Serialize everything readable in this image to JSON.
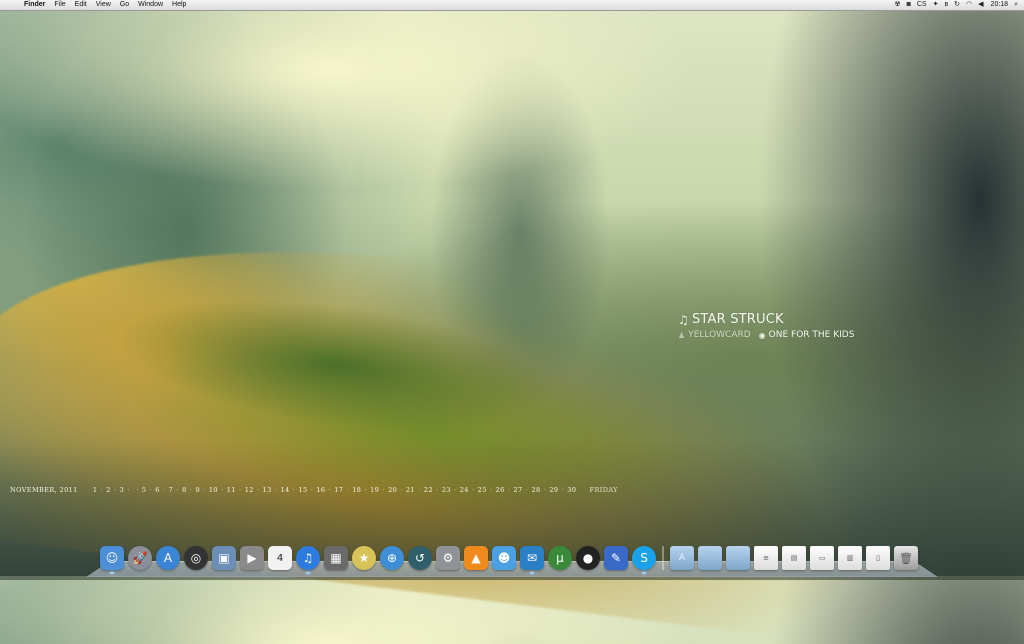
{
  "menubar": {
    "apple": "",
    "app": "Finder",
    "items": [
      "File",
      "Edit",
      "View",
      "Go",
      "Window",
      "Help"
    ],
    "status_icons": [
      "radiation-icon",
      "camera-icon",
      "cs-indicator",
      "twitter-icon",
      "bluetooth-icon",
      "timemachine-icon",
      "wifi-icon",
      "volume-icon"
    ],
    "status_text": "CS",
    "clock": "20:18",
    "spotlight": "search-icon"
  },
  "now_playing": {
    "song": "STAR STRUCK",
    "artist": "YELLOWCARD",
    "album": "ONE FOR THE KIDS"
  },
  "calendar": {
    "month": "NOVEMBER, 2011",
    "days": [
      "1",
      "2",
      "3",
      "",
      "5",
      "6",
      "7",
      "8",
      "9",
      "10",
      "11",
      "12",
      "13",
      "14",
      "15",
      "16",
      "17",
      "18",
      "19",
      "20",
      "21",
      "22",
      "23",
      "24",
      "25",
      "26",
      "27",
      "28",
      "29",
      "30"
    ],
    "today_symbol": "",
    "weekday": "FRIDAY"
  },
  "dock": {
    "apps": [
      {
        "name": "finder-icon",
        "color": "#4a8fd8",
        "glyph": "☺",
        "round": false,
        "running": true
      },
      {
        "name": "launchpad-icon",
        "color": "#8a8f99",
        "glyph": "🚀",
        "round": true,
        "running": false
      },
      {
        "name": "app-store-icon",
        "color": "#3a85d6",
        "glyph": "A",
        "round": true,
        "running": false
      },
      {
        "name": "dashboard-icon",
        "color": "#333",
        "glyph": "◎",
        "round": true,
        "running": false
      },
      {
        "name": "preview-icon",
        "color": "#6b8fb7",
        "glyph": "▣",
        "round": false,
        "running": false
      },
      {
        "name": "facetime-icon",
        "color": "#8a8a8a",
        "glyph": "▶",
        "round": false,
        "running": false
      },
      {
        "name": "calendar-icon",
        "color": "#f2f2f2",
        "glyph": "4",
        "round": false,
        "running": false
      },
      {
        "name": "itunes-icon",
        "color": "#2e7be0",
        "glyph": "♫",
        "round": true,
        "running": true
      },
      {
        "name": "iphoto-icon",
        "color": "#6a6a6a",
        "glyph": "▦",
        "round": false,
        "running": false
      },
      {
        "name": "imovie-icon",
        "color": "#d8c25a",
        "glyph": "★",
        "round": true,
        "running": false
      },
      {
        "name": "safari-icon",
        "color": "#3f8ed8",
        "glyph": "⊕",
        "round": true,
        "running": false
      },
      {
        "name": "time-machine-icon",
        "color": "#2f5f6a",
        "glyph": "↺",
        "round": true,
        "running": false
      },
      {
        "name": "system-preferences-icon",
        "color": "#8f9296",
        "glyph": "⚙",
        "round": false,
        "running": false
      },
      {
        "name": "vlc-icon",
        "color": "#f08a1c",
        "glyph": "▲",
        "round": false,
        "running": false
      },
      {
        "name": "messenger-icon",
        "color": "#4aa0e0",
        "glyph": "☻",
        "round": false,
        "running": false
      },
      {
        "name": "twitter-icon",
        "color": "#2b7fc4",
        "glyph": "✉",
        "round": false,
        "running": true
      },
      {
        "name": "utorrent-icon",
        "color": "#3a8a3a",
        "glyph": "µ",
        "round": true,
        "running": false
      },
      {
        "name": "camera-icon",
        "color": "#222",
        "glyph": "●",
        "round": true,
        "running": false
      },
      {
        "name": "xcode-icon",
        "color": "#3a6ac8",
        "glyph": "✎",
        "round": false,
        "running": false
      },
      {
        "name": "skype-icon",
        "color": "#1aa3e8",
        "glyph": "S",
        "round": true,
        "running": true
      }
    ],
    "stacks": [
      {
        "name": "applications-folder-icon",
        "kind": "folder",
        "glyph": "A"
      },
      {
        "name": "documents-folder-icon",
        "kind": "folder",
        "glyph": ""
      },
      {
        "name": "downloads-folder-icon",
        "kind": "folder",
        "glyph": ""
      },
      {
        "name": "document-stack-icon",
        "kind": "doc",
        "glyph": "≡"
      },
      {
        "name": "document-stack-icon-2",
        "kind": "doc",
        "glyph": "▤"
      },
      {
        "name": "screenshot-stack-icon",
        "kind": "doc",
        "glyph": "▭"
      },
      {
        "name": "file-stack-icon",
        "kind": "doc",
        "glyph": "▥"
      },
      {
        "name": "notes-stack-icon",
        "kind": "doc",
        "glyph": "▯"
      },
      {
        "name": "trash-icon",
        "kind": "trash",
        "glyph": "🗑"
      }
    ]
  }
}
